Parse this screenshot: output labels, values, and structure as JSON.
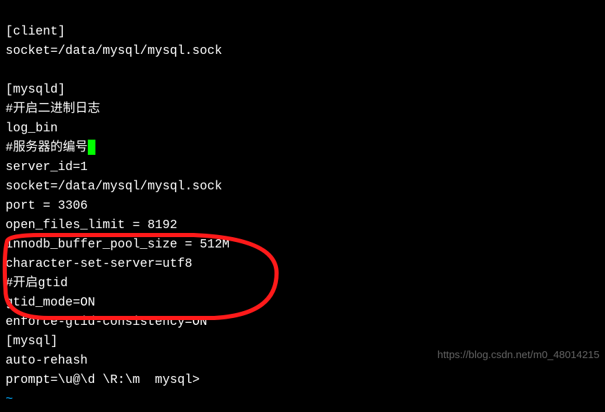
{
  "terminal": {
    "lines": [
      "[client]",
      "socket=/data/mysql/mysql.sock",
      "",
      "[mysqld]",
      "#开启二进制日志",
      "log_bin",
      "#服务器的编号",
      "server_id=1",
      "socket=/data/mysql/mysql.sock",
      "port = 3306",
      "open_files_limit = 8192",
      "innodb_buffer_pool_size = 512M",
      "character-set-server=utf8",
      "#开启gtid",
      "gtid_mode=ON",
      "enforce-gtid-consistency=ON",
      "[mysql]",
      "auto-rehash",
      "prompt=\\u@\\d \\R:\\m  mysql>"
    ],
    "tilde": "~",
    "cursor_line_index": 6
  },
  "watermark": "https://blog.csdn.net/m0_48014215",
  "annotation": {
    "color": "#ff1a1a",
    "stroke_width": 6
  }
}
